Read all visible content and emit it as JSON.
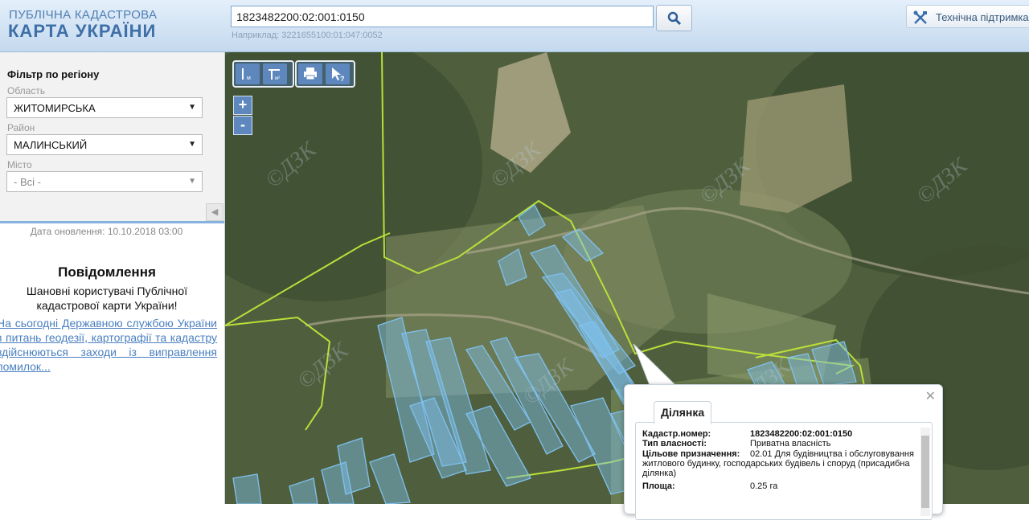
{
  "header": {
    "logo_line1": "ПУБЛІЧНА КАДАСТРОВА",
    "logo_line2": "КАРТА УКРАЇНИ",
    "search_value": "1823482200:02:001:0150",
    "search_hint": "Наприклад: 3221655100:01:047:0052",
    "support_label": "Технічна підтримка"
  },
  "sidebar": {
    "filter_title": "Фільтр по регіону",
    "oblast_label": "Область",
    "oblast_value": "ЖИТОМИРСЬКА",
    "rayon_label": "Район",
    "rayon_value": "МАЛИНСЬКИЙ",
    "city_label": "Місто",
    "city_value": "- Всі -",
    "update_date": "Дата оновлення: 10.10.2018 03:00",
    "notice_title": "Повідомлення",
    "notice_text": "Шановні користувачі Публічної кадастрової карти України!",
    "notice_link": "На сьогодні Державною службою України з питань геодезії, картографії та кадастру здійснюються заходи із виправлення помилок..."
  },
  "map": {
    "watermark": "©ДЗК",
    "zoom_in": "+",
    "zoom_out": "-"
  },
  "popup": {
    "tab_label": "Ділянка",
    "rows": [
      {
        "label": "Кадастр.номер:",
        "value": "1823482200:02:001:0150"
      },
      {
        "label": "Тип власності:",
        "value": "Приватна власність"
      },
      {
        "label": "Цільове призначення:",
        "value": "02.01 Для будівництва і обслуговування житлового будинку, господарських будівель і споруд (присадибна ділянка)"
      },
      {
        "label": "Площа:",
        "value": "0.25 га"
      }
    ]
  },
  "colors": {
    "accent": "#5e88bd",
    "parcel": "#7fc0ee",
    "boundary": "#b8e03a",
    "link": "#4a7fc0"
  }
}
